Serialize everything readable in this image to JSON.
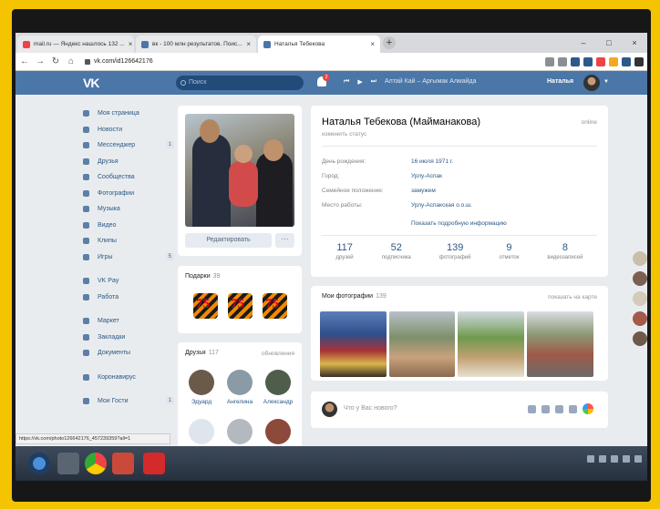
{
  "browser": {
    "tabs": [
      {
        "label": "mail.ru — Яндекс нашлось 132 ...",
        "color": "#e44"
      },
      {
        "label": "вк - 100 млн результатов. Поис...",
        "color": "#4a76a8"
      },
      {
        "label": "Наталья Тебекова",
        "color": "#4a76a8"
      }
    ],
    "new_tab": "+",
    "url": "vk.com/id126642176",
    "status_url": "https://vk.com/photo126642176_457239359?all=1"
  },
  "vk_header": {
    "logo": "VK",
    "search_placeholder": "Поиск",
    "notification_count": "2",
    "player_controls": [
      "⏮",
      "▶",
      "⏭"
    ],
    "track": "Алтай Кай – Аргымак Алмайда",
    "user_name": "Наталья"
  },
  "menu": [
    {
      "label": "Моя страница",
      "icon": "home-icon",
      "count": ""
    },
    {
      "label": "Новости",
      "icon": "news-icon",
      "count": ""
    },
    {
      "label": "Мессенджер",
      "icon": "messenger-icon",
      "count": "1"
    },
    {
      "label": "Друзья",
      "icon": "friends-icon",
      "count": ""
    },
    {
      "label": "Сообщества",
      "icon": "communities-icon",
      "count": ""
    },
    {
      "label": "Фотографии",
      "icon": "photos-icon",
      "count": ""
    },
    {
      "label": "Музыка",
      "icon": "music-icon",
      "count": ""
    },
    {
      "label": "Видео",
      "icon": "video-icon",
      "count": ""
    },
    {
      "label": "Клипы",
      "icon": "clips-icon",
      "count": ""
    },
    {
      "label": "Игры",
      "icon": "games-icon",
      "count": "5"
    },
    {
      "label": "VK Pay",
      "icon": "vkpay-icon",
      "count": ""
    },
    {
      "label": "Работа",
      "icon": "work-icon",
      "count": ""
    },
    {
      "label": "Маркет",
      "icon": "market-icon",
      "count": ""
    },
    {
      "label": "Закладки",
      "icon": "bookmarks-icon",
      "count": ""
    },
    {
      "label": "Документы",
      "icon": "documents-icon",
      "count": ""
    },
    {
      "label": "Коронавирус",
      "icon": "coronavirus-icon",
      "count": ""
    },
    {
      "label": "Мои Гости",
      "icon": "guests-icon",
      "count": "1"
    }
  ],
  "photo_card": {
    "edit_label": "Редактировать",
    "more_label": "···"
  },
  "gifts": {
    "title": "Подарки",
    "count": "39",
    "items": [
      "75",
      "75",
      "75"
    ]
  },
  "friends": {
    "title": "Друзья",
    "count": "117",
    "link": "обновления",
    "items": [
      {
        "name": "Эдуард",
        "color": "#6b5a4a"
      },
      {
        "name": "Ангелина",
        "color": "#8a9aa6"
      },
      {
        "name": "Александр",
        "color": "#4f5e4a"
      }
    ]
  },
  "profile": {
    "name": "Наталья Тебекова (Майманакова)",
    "online": "online",
    "status": "изменить статус",
    "info": [
      {
        "key": "День рождения:",
        "value": "16 июля 1971 г."
      },
      {
        "key": "Город:",
        "value": "Урлу-Аспак"
      },
      {
        "key": "Семейное положение:",
        "value": "замужем"
      },
      {
        "key": "Место работы:",
        "value": "Урлу-Аспакская о.о.ш."
      }
    ],
    "more_info": "Показать подробную информацию",
    "counters": [
      {
        "value": "117",
        "label": "друзей"
      },
      {
        "value": "52",
        "label": "подписчика"
      },
      {
        "value": "139",
        "label": "фотографий"
      },
      {
        "value": "9",
        "label": "отметок"
      },
      {
        "value": "8",
        "label": "видеозаписей"
      }
    ]
  },
  "my_photos": {
    "title": "Мои фотографии",
    "count": "139",
    "link": "показать на карте"
  },
  "post": {
    "placeholder": "Что у Вас нового?"
  },
  "colors": {
    "vk_blue": "#4a76a8",
    "link": "#2a5885",
    "frame": "#f5c400"
  }
}
